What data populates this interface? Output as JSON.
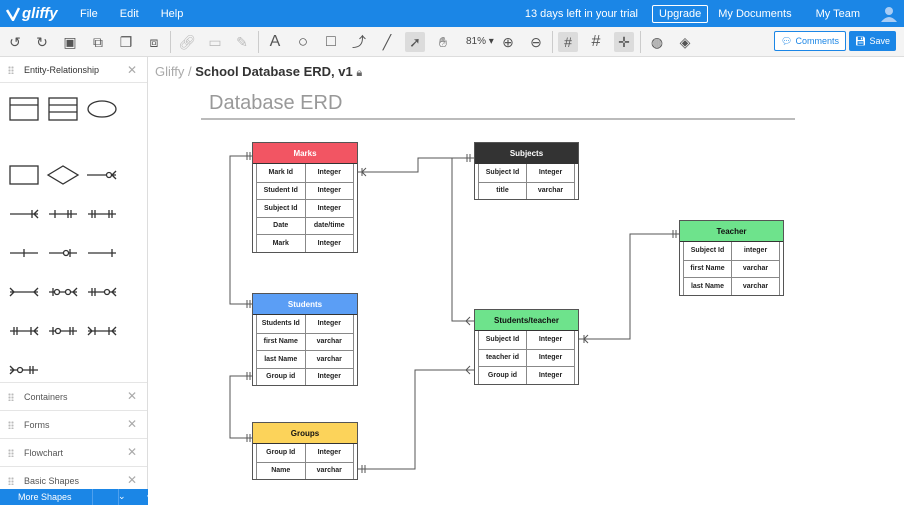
{
  "app": {
    "logo": "gliffy"
  },
  "menu": [
    "File",
    "Edit",
    "Help"
  ],
  "nav": {
    "trial": "13 days left in your trial",
    "upgrade": "Upgrade",
    "my_documents": "My Documents",
    "my_team": "My Team"
  },
  "toolbar": {
    "zoom": "81%",
    "comments": "Comments",
    "save": "Save"
  },
  "sidebar": {
    "library": "Entity-Relationship",
    "sections": [
      "Containers",
      "Forms",
      "Flowchart",
      "Basic Shapes"
    ],
    "more": "More Shapes"
  },
  "breadcrumb": {
    "root": "Gliffy /",
    "doc": "School Database ERD, v1"
  },
  "diagram": {
    "title": "Database ERD",
    "entities": [
      {
        "name": "Marks",
        "color": "#f25563",
        "rows": [
          [
            "Mark Id",
            "Integer"
          ],
          [
            "Student Id",
            "Integer"
          ],
          [
            "Subject Id",
            "Integer"
          ],
          [
            "Date",
            "date/time"
          ],
          [
            "Mark",
            "Integer"
          ]
        ]
      },
      {
        "name": "Subjects",
        "color": "#333333",
        "rows": [
          [
            "Subject Id",
            "Integer"
          ],
          [
            "title",
            "varchar"
          ]
        ]
      },
      {
        "name": "Teacher",
        "color": "#6ee38c",
        "rows": [
          [
            "Subject Id",
            "integer"
          ],
          [
            "first Name",
            "varchar"
          ],
          [
            "last Name",
            "varchar"
          ]
        ]
      },
      {
        "name": "Students",
        "color": "#5b9ef5",
        "rows": [
          [
            "Students Id",
            "Integer"
          ],
          [
            "first Name",
            "varchar"
          ],
          [
            "last Name",
            "varchar"
          ],
          [
            "Group id",
            "Integer"
          ]
        ]
      },
      {
        "name": "Students/teacher",
        "color": "#6ee38c",
        "rows": [
          [
            "Subject Id",
            "Integer"
          ],
          [
            "teacher id",
            "Integer"
          ],
          [
            "Group id",
            "Integer"
          ]
        ]
      },
      {
        "name": "Groups",
        "color": "#fcd35a",
        "rows": [
          [
            "Group Id",
            "Integer"
          ],
          [
            "Name",
            "varchar"
          ]
        ]
      }
    ]
  }
}
